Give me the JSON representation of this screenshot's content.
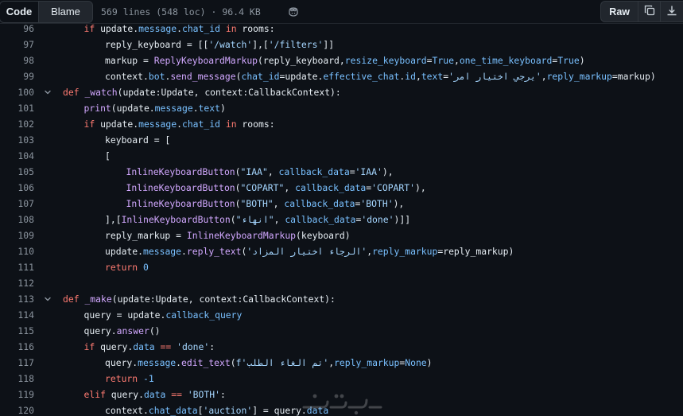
{
  "toolbar": {
    "code_label": "Code",
    "blame_label": "Blame",
    "file_info": "569 lines (548 loc) · 96.4 KB",
    "raw_label": "Raw"
  },
  "icons": {
    "copilot": "copilot-icon",
    "copy": "copy-icon",
    "download": "download-icon",
    "fold": "chevron-down-icon",
    "watermark": "khamsat-watermark-logo"
  },
  "colors": {
    "background": "#0d1117",
    "keyword": "#ff7b72",
    "function": "#d2a8ff",
    "attribute": "#79c0ff",
    "string": "#a5d6ff",
    "text": "#e6edf3",
    "line_number": "#8b949e"
  },
  "lines": [
    {
      "n": "96",
      "indent": 1,
      "fold": false,
      "tokens": [
        [
          "kw",
          "if"
        ],
        [
          "p",
          " update."
        ],
        [
          "at",
          "message"
        ],
        [
          "p",
          "."
        ],
        [
          "at",
          "chat_id"
        ],
        [
          "p",
          " "
        ],
        [
          "kw",
          "in"
        ],
        [
          "p",
          " rooms:"
        ]
      ]
    },
    {
      "n": "97",
      "indent": 2,
      "fold": false,
      "tokens": [
        [
          "p",
          "reply_keyboard = [["
        ],
        [
          "st",
          "'/watch'"
        ],
        [
          "p",
          "],["
        ],
        [
          "st",
          "'/filters'"
        ],
        [
          "p",
          "]]"
        ]
      ]
    },
    {
      "n": "98",
      "indent": 2,
      "fold": false,
      "tokens": [
        [
          "p",
          "markup = "
        ],
        [
          "fn",
          "ReplyKeyboardMarkup"
        ],
        [
          "p",
          "(reply_keyboard,"
        ],
        [
          "at",
          "resize_keyboard"
        ],
        [
          "p",
          "="
        ],
        [
          "nu",
          "True"
        ],
        [
          "p",
          ","
        ],
        [
          "at",
          "one_time_keyboard"
        ],
        [
          "p",
          "="
        ],
        [
          "nu",
          "True"
        ],
        [
          "p",
          ")"
        ]
      ]
    },
    {
      "n": "99",
      "indent": 2,
      "fold": false,
      "tokens": [
        [
          "p",
          "context."
        ],
        [
          "at",
          "bot"
        ],
        [
          "p",
          "."
        ],
        [
          "fn",
          "send_message"
        ],
        [
          "p",
          "("
        ],
        [
          "at",
          "chat_id"
        ],
        [
          "p",
          "=update."
        ],
        [
          "at",
          "effective_chat"
        ],
        [
          "p",
          "."
        ],
        [
          "at",
          "id"
        ],
        [
          "p",
          ","
        ],
        [
          "at",
          "text"
        ],
        [
          "p",
          "="
        ],
        [
          "st",
          "'يرجي اختيار امر'"
        ],
        [
          "p",
          ","
        ],
        [
          "at",
          "reply_markup"
        ],
        [
          "p",
          "=markup)"
        ]
      ]
    },
    {
      "n": "100",
      "indent": 0,
      "fold": true,
      "tokens": [
        [
          "kw",
          "def"
        ],
        [
          "p",
          " "
        ],
        [
          "fn",
          "_watch"
        ],
        [
          "p",
          "(update:Update, context:CallbackContext):"
        ]
      ]
    },
    {
      "n": "101",
      "indent": 1,
      "fold": false,
      "tokens": [
        [
          "fn",
          "print"
        ],
        [
          "p",
          "(update."
        ],
        [
          "at",
          "message"
        ],
        [
          "p",
          "."
        ],
        [
          "at",
          "text"
        ],
        [
          "p",
          ")"
        ]
      ]
    },
    {
      "n": "102",
      "indent": 1,
      "fold": false,
      "tokens": [
        [
          "kw",
          "if"
        ],
        [
          "p",
          " update."
        ],
        [
          "at",
          "message"
        ],
        [
          "p",
          "."
        ],
        [
          "at",
          "chat_id"
        ],
        [
          "p",
          " "
        ],
        [
          "kw",
          "in"
        ],
        [
          "p",
          " rooms:"
        ]
      ]
    },
    {
      "n": "103",
      "indent": 2,
      "fold": false,
      "tokens": [
        [
          "p",
          "keyboard = ["
        ]
      ]
    },
    {
      "n": "104",
      "indent": 2,
      "fold": false,
      "tokens": [
        [
          "p",
          "["
        ]
      ]
    },
    {
      "n": "105",
      "indent": 3,
      "fold": false,
      "tokens": [
        [
          "fn",
          "InlineKeyboardButton"
        ],
        [
          "p",
          "("
        ],
        [
          "st",
          "\"IAA\""
        ],
        [
          "p",
          ", "
        ],
        [
          "at",
          "callback_data"
        ],
        [
          "p",
          "="
        ],
        [
          "st",
          "'IAA'"
        ],
        [
          "p",
          "),"
        ]
      ]
    },
    {
      "n": "106",
      "indent": 3,
      "fold": false,
      "tokens": [
        [
          "fn",
          "InlineKeyboardButton"
        ],
        [
          "p",
          "("
        ],
        [
          "st",
          "\"COPART\""
        ],
        [
          "p",
          ", "
        ],
        [
          "at",
          "callback_data"
        ],
        [
          "p",
          "="
        ],
        [
          "st",
          "'COPART'"
        ],
        [
          "p",
          "),"
        ]
      ]
    },
    {
      "n": "107",
      "indent": 3,
      "fold": false,
      "tokens": [
        [
          "fn",
          "InlineKeyboardButton"
        ],
        [
          "p",
          "("
        ],
        [
          "st",
          "\"BOTH\""
        ],
        [
          "p",
          ", "
        ],
        [
          "at",
          "callback_data"
        ],
        [
          "p",
          "="
        ],
        [
          "st",
          "'BOTH'"
        ],
        [
          "p",
          "),"
        ]
      ]
    },
    {
      "n": "108",
      "indent": 2,
      "fold": false,
      "tokens": [
        [
          "p",
          "],["
        ],
        [
          "fn",
          "InlineKeyboardButton"
        ],
        [
          "p",
          "("
        ],
        [
          "st",
          "\"انهاء\""
        ],
        [
          "p",
          ", "
        ],
        [
          "at",
          "callback_data"
        ],
        [
          "p",
          "="
        ],
        [
          "st",
          "'done'"
        ],
        [
          "p",
          ")]]"
        ]
      ]
    },
    {
      "n": "109",
      "indent": 2,
      "fold": false,
      "tokens": [
        [
          "p",
          "reply_markup = "
        ],
        [
          "fn",
          "InlineKeyboardMarkup"
        ],
        [
          "p",
          "(keyboard)"
        ]
      ]
    },
    {
      "n": "110",
      "indent": 2,
      "fold": false,
      "tokens": [
        [
          "p",
          "update."
        ],
        [
          "at",
          "message"
        ],
        [
          "p",
          "."
        ],
        [
          "fn",
          "reply_text"
        ],
        [
          "p",
          "("
        ],
        [
          "st",
          "'الرجاء اختيار المزاد'"
        ],
        [
          "p",
          ","
        ],
        [
          "at",
          "reply_markup"
        ],
        [
          "p",
          "=reply_markup)"
        ]
      ]
    },
    {
      "n": "111",
      "indent": 2,
      "fold": false,
      "tokens": [
        [
          "kw",
          "return"
        ],
        [
          "p",
          " "
        ],
        [
          "nu",
          "0"
        ]
      ]
    },
    {
      "n": "112",
      "indent": 0,
      "fold": false,
      "tokens": []
    },
    {
      "n": "113",
      "indent": 0,
      "fold": true,
      "tokens": [
        [
          "kw",
          "def"
        ],
        [
          "p",
          " "
        ],
        [
          "fn",
          "_make"
        ],
        [
          "p",
          "(update:Update, context:CallbackContext):"
        ]
      ]
    },
    {
      "n": "114",
      "indent": 1,
      "fold": false,
      "tokens": [
        [
          "p",
          "query = update."
        ],
        [
          "at",
          "callback_query"
        ]
      ]
    },
    {
      "n": "115",
      "indent": 1,
      "fold": false,
      "tokens": [
        [
          "p",
          "query."
        ],
        [
          "fn",
          "answer"
        ],
        [
          "p",
          "()"
        ]
      ]
    },
    {
      "n": "116",
      "indent": 1,
      "fold": false,
      "tokens": [
        [
          "kw",
          "if"
        ],
        [
          "p",
          " query."
        ],
        [
          "at",
          "data"
        ],
        [
          "p",
          " "
        ],
        [
          "kw",
          "=="
        ],
        [
          "p",
          " "
        ],
        [
          "st",
          "'done'"
        ],
        [
          "p",
          ":"
        ]
      ]
    },
    {
      "n": "117",
      "indent": 2,
      "fold": false,
      "tokens": [
        [
          "p",
          "query."
        ],
        [
          "at",
          "message"
        ],
        [
          "p",
          "."
        ],
        [
          "fn",
          "edit_text"
        ],
        [
          "p",
          "("
        ],
        [
          "st",
          "f'تم الغاء الطلب'"
        ],
        [
          "p",
          ","
        ],
        [
          "at",
          "reply_markup"
        ],
        [
          "p",
          "="
        ],
        [
          "nu",
          "None"
        ],
        [
          "p",
          ")"
        ]
      ]
    },
    {
      "n": "118",
      "indent": 2,
      "fold": false,
      "tokens": [
        [
          "kw",
          "return"
        ],
        [
          "p",
          " "
        ],
        [
          "nu",
          "-1"
        ]
      ]
    },
    {
      "n": "119",
      "indent": 1,
      "fold": false,
      "tokens": [
        [
          "kw",
          "elif"
        ],
        [
          "p",
          " query."
        ],
        [
          "at",
          "data"
        ],
        [
          "p",
          " "
        ],
        [
          "kw",
          "=="
        ],
        [
          "p",
          " "
        ],
        [
          "st",
          "'BOTH'"
        ],
        [
          "p",
          ":"
        ]
      ]
    },
    {
      "n": "120",
      "indent": 2,
      "fold": false,
      "tokens": [
        [
          "p",
          "context."
        ],
        [
          "at",
          "chat_data"
        ],
        [
          "p",
          "["
        ],
        [
          "st",
          "'auction'"
        ],
        [
          "p",
          "] = query."
        ],
        [
          "at",
          "data"
        ]
      ]
    }
  ]
}
